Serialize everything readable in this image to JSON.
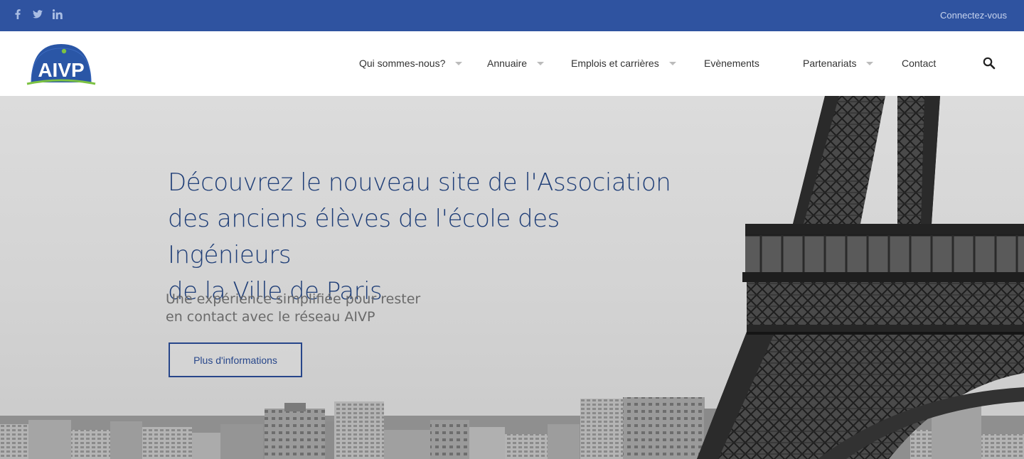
{
  "topbar": {
    "social": [
      {
        "icon": "facebook-icon",
        "glyph": "f"
      },
      {
        "icon": "twitter-icon",
        "glyph": "t"
      },
      {
        "icon": "linkedin-icon",
        "glyph": "in"
      }
    ],
    "connect_label": "Connectez-vous"
  },
  "header": {
    "logo_text": "AIVP",
    "nav": [
      {
        "label": "Qui sommes-nous?",
        "has_dropdown": true
      },
      {
        "label": "Annuaire",
        "has_dropdown": true
      },
      {
        "label": "Emplois et carrières",
        "has_dropdown": true
      },
      {
        "label": "Evènements",
        "has_dropdown": false
      },
      {
        "label": "Partenariats",
        "has_dropdown": true
      },
      {
        "label": "Contact",
        "has_dropdown": false
      }
    ]
  },
  "hero": {
    "title_lines": [
      "Découvrez le nouveau site de l'Association",
      "des anciens élèves de l'école des Ingénieurs",
      "de la Ville de Paris"
    ],
    "subtitle_lines": [
      "Une expérience simplifiée pour rester",
      "en contact avec le réseau AIVP"
    ],
    "button_label": "Plus d'informations"
  },
  "colors": {
    "topbar": "#2f53a0",
    "accent": "#27468a",
    "title": "#1f3e77",
    "logo_green": "#7cc242"
  }
}
